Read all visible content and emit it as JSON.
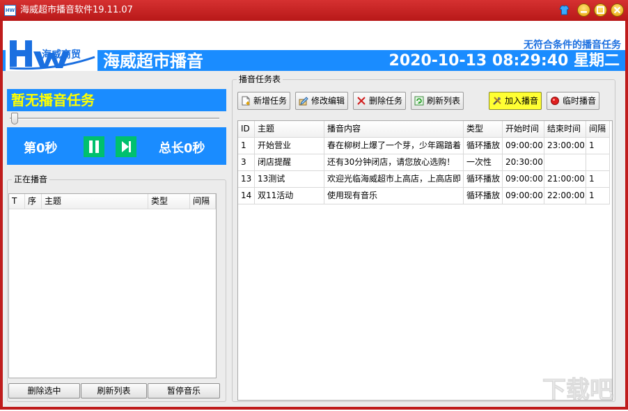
{
  "window": {
    "title": "海威超市播音软件19.11.07",
    "icon": "app-logo-icon"
  },
  "header": {
    "logo_text": "HW",
    "logo_subtitle": "海威商贸",
    "brand_title": "海威超市播音",
    "status_message": "无符合条件的播音任务",
    "datetime": "2020-10-13 08:29:40 星期二"
  },
  "player": {
    "now_playing": "暂无播音任务",
    "progress": 0,
    "current_label": "第0秒",
    "total_label": "总长0秒"
  },
  "playing_section": {
    "label": "正在播音",
    "columns": [
      "T",
      "序",
      "主题",
      "类型",
      "间隔"
    ],
    "rows": []
  },
  "bottom_buttons": {
    "delete_selected": "删除选中",
    "refresh_list": "刷新列表",
    "pause_music": "暂停音乐"
  },
  "task_section": {
    "label": "播音任务表",
    "toolbar": {
      "new_task": "新增任务",
      "edit": "修改编辑",
      "delete_task": "删除任务",
      "refresh": "刷新列表",
      "add_broadcast": "加入播音",
      "temp_broadcast": "临时播音"
    },
    "columns": [
      "ID",
      "主题",
      "播音内容",
      "类型",
      "开始时间",
      "结束时间",
      "间隔"
    ],
    "rows": [
      {
        "id": "1",
        "topic": "开始营业",
        "content": "春在柳树上爆了一个芽，少年踢踏着",
        "type": "循环播放",
        "start": "09:00:00",
        "end": "23:00:00",
        "interval": "1"
      },
      {
        "id": "3",
        "topic": "闭店提醒",
        "content": "还有30分钟闭店，请您放心选购！",
        "type": "一次性",
        "start": "20:30:00",
        "end": "",
        "interval": ""
      },
      {
        "id": "13",
        "topic": "13测试",
        "content": "欢迎光临海威超市上高店，上高店即",
        "type": "循环播放",
        "start": "09:00:00",
        "end": "21:00:00",
        "interval": "1"
      },
      {
        "id": "14",
        "topic": "双11活动",
        "content": "使用现有音乐",
        "type": "循环播放",
        "start": "09:00:00",
        "end": "22:00:00",
        "interval": "1"
      }
    ]
  },
  "watermark": {
    "text": "下载吧"
  },
  "colors": {
    "title_bar": "#c62020",
    "accent_blue": "#1a8cff",
    "play_green": "#00c06e",
    "highlight_yellow": "#ffff00"
  }
}
